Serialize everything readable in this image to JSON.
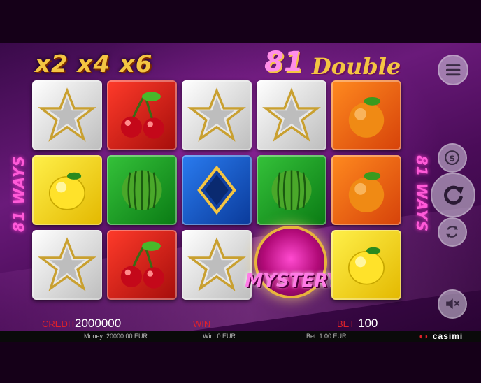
{
  "header": {
    "multipliers": "x2 x4 x6",
    "logo_number": "81",
    "logo_word": "Double"
  },
  "ways_label": "81 WAYS",
  "reels": {
    "rows": [
      [
        "star",
        "cherry",
        "star",
        "star",
        "orange"
      ],
      [
        "lemon",
        "watermelon",
        "diamond",
        "watermelon",
        "orange"
      ],
      [
        "star",
        "cherry",
        "star",
        "mystery",
        "lemon"
      ]
    ],
    "mystery_label": "MYSTERY"
  },
  "side_buttons": [
    {
      "name": "menu-icon"
    },
    {
      "name": "coin-icon"
    },
    {
      "name": "spin-icon"
    },
    {
      "name": "autoplay-icon"
    },
    {
      "name": "mute-icon"
    }
  ],
  "info": {
    "credit_label": "CREDIT",
    "credit_value": "2000000",
    "win_label": "WIN",
    "win_value": "",
    "bet_label": "BET",
    "bet_value": "100"
  },
  "footer": {
    "money": "Money: 20000.00 EUR",
    "win": "Win: 0 EUR",
    "bet": "Bet: 1.00 EUR",
    "brand": "casimi"
  },
  "colors": {
    "accent_red": "#e0222a",
    "gold": "#f4c542",
    "magenta": "#ff5ad8"
  }
}
